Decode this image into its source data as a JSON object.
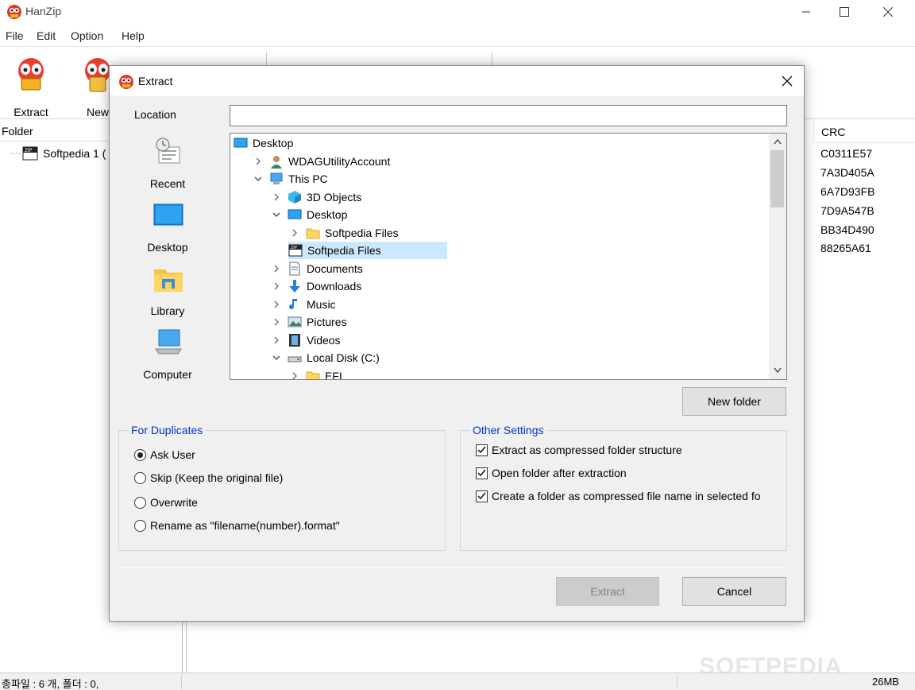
{
  "app": {
    "title": "HanZip"
  },
  "window_controls": {
    "minimize": "—",
    "maximize": "☐",
    "close": "✕"
  },
  "menu": [
    "File",
    "Edit",
    "Option",
    "Help"
  ],
  "toolbar": {
    "extract_label": "Extract",
    "new_label": "New"
  },
  "folder_pane": {
    "header": "Folder",
    "root_item": "Softpedia 1 ("
  },
  "columns": {
    "crc_header": "CRC",
    "crc_values": [
      "C0311E57",
      "7A3D405A",
      "6A7D93FB",
      "7D9A547B",
      "BB34D490",
      "88265A61"
    ]
  },
  "status": {
    "left": "총파일 : 6 개, 폴더 : 0,",
    "right": "26MB"
  },
  "watermark": "SOFTPEDIA",
  "dialog": {
    "title": "Extract",
    "close": "✕",
    "location_label": "Location",
    "location_value": "",
    "places": [
      "Recent",
      "Desktop",
      "Library",
      "Computer"
    ],
    "tree": [
      {
        "label": "Desktop",
        "icon": "desktop-icon",
        "expand": "none",
        "selected": false
      },
      {
        "label": "WDAGUtilityAccount",
        "icon": "user-icon",
        "expand": "collapsed",
        "selected": false
      },
      {
        "label": "This PC",
        "icon": "computer-icon",
        "expand": "expanded",
        "selected": false
      },
      {
        "label": "3D Objects",
        "icon": "cube-icon",
        "expand": "collapsed",
        "selected": false
      },
      {
        "label": "Desktop",
        "icon": "desktop-icon",
        "expand": "expanded",
        "selected": false
      },
      {
        "label": "Softpedia Files",
        "icon": "folder-icon",
        "expand": "collapsed",
        "selected": false
      },
      {
        "label": "Softpedia Files",
        "icon": "zip-icon",
        "expand": "none",
        "selected": true
      },
      {
        "label": "Documents",
        "icon": "document-icon",
        "expand": "collapsed",
        "selected": false
      },
      {
        "label": "Downloads",
        "icon": "download-icon",
        "expand": "collapsed",
        "selected": false
      },
      {
        "label": "Music",
        "icon": "music-icon",
        "expand": "collapsed",
        "selected": false
      },
      {
        "label": "Pictures",
        "icon": "pictures-icon",
        "expand": "collapsed",
        "selected": false
      },
      {
        "label": "Videos",
        "icon": "video-icon",
        "expand": "collapsed",
        "selected": false
      },
      {
        "label": "Local Disk (C:)",
        "icon": "drive-icon",
        "expand": "expanded",
        "selected": false
      },
      {
        "label": "EFI",
        "icon": "folder-icon",
        "expand": "collapsed",
        "selected": false
      }
    ],
    "new_folder_label": "New folder",
    "duplicates": {
      "title": "For Duplicates",
      "options": [
        "Ask User",
        "Skip (Keep the original file)",
        "Overwrite",
        "Rename as \"filename(number).format\""
      ],
      "selected_index": 0
    },
    "other": {
      "title": "Other Settings",
      "options": [
        "Extract as compressed folder structure",
        "Open folder after extraction",
        "Create a folder as compressed file name in selected fo"
      ],
      "checked": [
        true,
        true,
        true
      ]
    },
    "extract_label": "Extract",
    "cancel_label": "Cancel"
  }
}
